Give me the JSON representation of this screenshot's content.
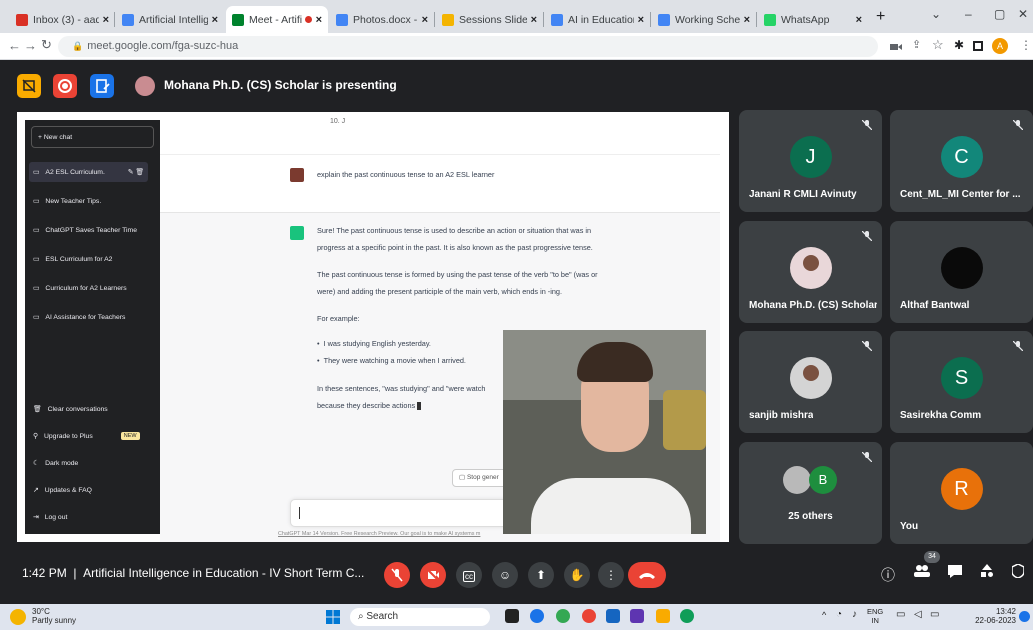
{
  "browser": {
    "tabs": [
      {
        "label": "Inbox (3) - aadc@",
        "color": "#d93025"
      },
      {
        "label": "Artificial Intelligen",
        "color": "#4285f4"
      },
      {
        "label": "Meet - Artifi",
        "color": "#00832d"
      },
      {
        "label": "Photos.docx - Go",
        "color": "#4285f4"
      },
      {
        "label": "Sessions Slides -",
        "color": "#f4b400"
      },
      {
        "label": "AI in Education -",
        "color": "#4285f4"
      },
      {
        "label": "Working Schedul",
        "color": "#4285f4"
      },
      {
        "label": "WhatsApp",
        "color": "#25d366"
      }
    ],
    "new_tab": "+",
    "url": "meet.google.com/fga-suzc-hua",
    "profile_initial": "A"
  },
  "meet": {
    "presenter_text": "Mohana Ph.D. (CS) Scholar is presenting",
    "chatgpt": {
      "new_chat": "+ New chat",
      "history": [
        "A2 ESL Curriculum.",
        "New Teacher Tips.",
        "ChatGPT Saves Teacher Time",
        "ESL Curriculum for A2",
        "Curriculum for A2 Learners",
        "AI Assistance for Teachers"
      ],
      "bottom_items": [
        "Clear conversations",
        "Upgrade to Plus",
        "Dark mode",
        "Updates & FAQ",
        "Log out"
      ],
      "new_badge": "NEW",
      "list_end": "10. J",
      "user_prompt": "explain the past continuous tense to an A2 ESL learner",
      "answer_p1_l1": "Sure! The past continuous tense is used to describe an action or situation that was in",
      "answer_p1_l2": "progress at a specific point in the past. It is also known as the past progressive tense.",
      "answer_p2_l1": "The past continuous tense is formed by using the past tense of the verb \"to be\" (was or",
      "answer_p2_l2": "were) and adding the present participle of the main verb, which ends in -ing.",
      "answer_example": "For example:",
      "bullet1": "I was studying English yesterday.",
      "bullet2": "They were watching a movie when I arrived.",
      "answer_p4_l1": "In these sentences, \"was studying\" and \"were watch",
      "answer_p4_l2": "because they describe actions",
      "stop_button": "Stop gener",
      "footer": "ChatGPT Mar 14 Version. Free Research Preview. Our goal is to make AI systems m"
    },
    "participants": [
      {
        "name": "Janani R CMLI Avinuty",
        "initial": "J",
        "color": "#0b6e4f",
        "kind": "letter"
      },
      {
        "name": "Cent_ML_MI Center for ...",
        "initial": "C",
        "color": "#12877a",
        "kind": "letter"
      },
      {
        "name": "Mohana Ph.D. (CS) Scholar",
        "initial": "",
        "color": "#e9d7d9",
        "kind": "photo"
      },
      {
        "name": "Althaf Bantwal",
        "initial": "",
        "color": "#0a0a0a",
        "kind": "letter"
      },
      {
        "name": "sanjib mishra",
        "initial": "",
        "color": "#d4d4d4",
        "kind": "photo"
      },
      {
        "name": "Sasirekha Comm",
        "initial": "S",
        "color": "#0b6e4f",
        "kind": "letter"
      },
      {
        "name": "25 others",
        "initial": "B",
        "color": "#1e8e3e",
        "kind": "others"
      },
      {
        "name": "You",
        "initial": "R",
        "color": "#e8710a",
        "kind": "letter"
      }
    ],
    "time": "1:42 PM",
    "meeting_title": "Artificial Intelligence in Education - IV Short Term C...",
    "people_count": "34",
    "accent_red": "#ea4335"
  },
  "taskbar": {
    "temperature": "30°C",
    "weather": "Partly sunny",
    "search": "Search",
    "lang_top": "ENG",
    "lang_bottom": "IN",
    "clock_time": "13:42",
    "clock_date": "22-06-2023"
  }
}
